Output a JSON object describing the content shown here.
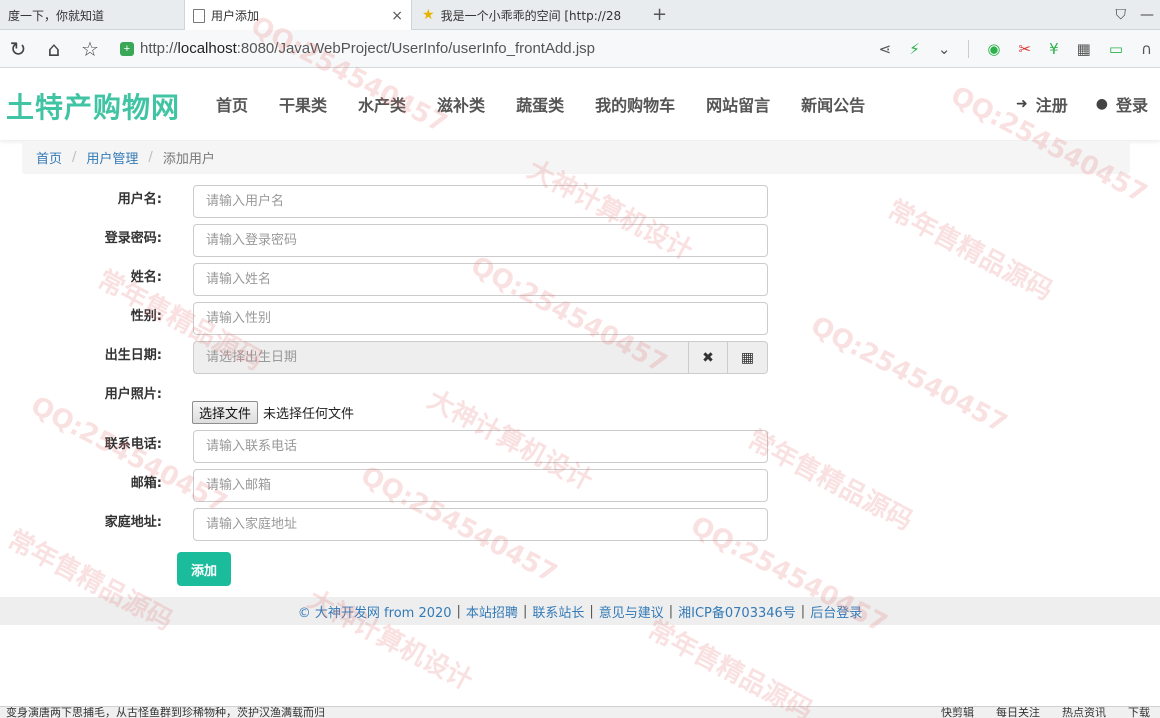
{
  "browser": {
    "tabs": [
      {
        "title": "度一下，你就知道"
      },
      {
        "title": "用户添加",
        "close": "×"
      },
      {
        "title": "我是一个小乖乖的空间 [http://28"
      }
    ],
    "new_tab": "+",
    "url": {
      "prefix": "http://",
      "host": "localhost",
      "rest": ":8080/JavaWebProject/UserInfo/userInfo_frontAdd.jsp"
    }
  },
  "site": {
    "logo": "土特产购物网",
    "menu": [
      "首页",
      "干果类",
      "水产类",
      "滋补类",
      "蔬蛋类",
      "我的购物车",
      "网站留言",
      "新闻公告"
    ],
    "register": "注册",
    "login": "登录"
  },
  "breadcrumb": {
    "home": "首页",
    "section": "用户管理",
    "current": "添加用户",
    "separator": "/"
  },
  "form": {
    "username": {
      "label": "用户名:",
      "placeholder": "请输入用户名"
    },
    "password": {
      "label": "登录密码:",
      "placeholder": "请输入登录密码"
    },
    "name": {
      "label": "姓名:",
      "placeholder": "请输入姓名"
    },
    "gender": {
      "label": "性别:",
      "placeholder": "请输入性别"
    },
    "birthday": {
      "label": "出生日期:",
      "placeholder": "请选择出生日期"
    },
    "photo": {
      "label": "用户照片:",
      "button": "选择文件",
      "status": "未选择任何文件"
    },
    "phone": {
      "label": "联系电话:",
      "placeholder": "请输入联系电话"
    },
    "email": {
      "label": "邮箱:",
      "placeholder": "请输入邮箱"
    },
    "address": {
      "label": "家庭地址:",
      "placeholder": "请输入家庭地址"
    },
    "submit": "添加"
  },
  "footer": {
    "links": [
      "© 大神开发网 from 2020",
      "本站招聘",
      "联系站长",
      "意见与建议",
      "湘ICP备0703346号",
      "后台登录"
    ]
  },
  "statusbar": {
    "left": "变身演唐两下思捕毛，从古怪鱼群到珍稀物种，茨护汉渔满载而归",
    "right": [
      "快剪辑",
      "每日关注",
      "热点资讯",
      "下载"
    ]
  },
  "watermark": {
    "lines": [
      "QQ:254540457",
      "常年售精品源码",
      "大神计算机设计"
    ]
  },
  "colors": {
    "accent": "#1abc9c",
    "logo": "#41c4a3",
    "link": "#337ab7"
  }
}
